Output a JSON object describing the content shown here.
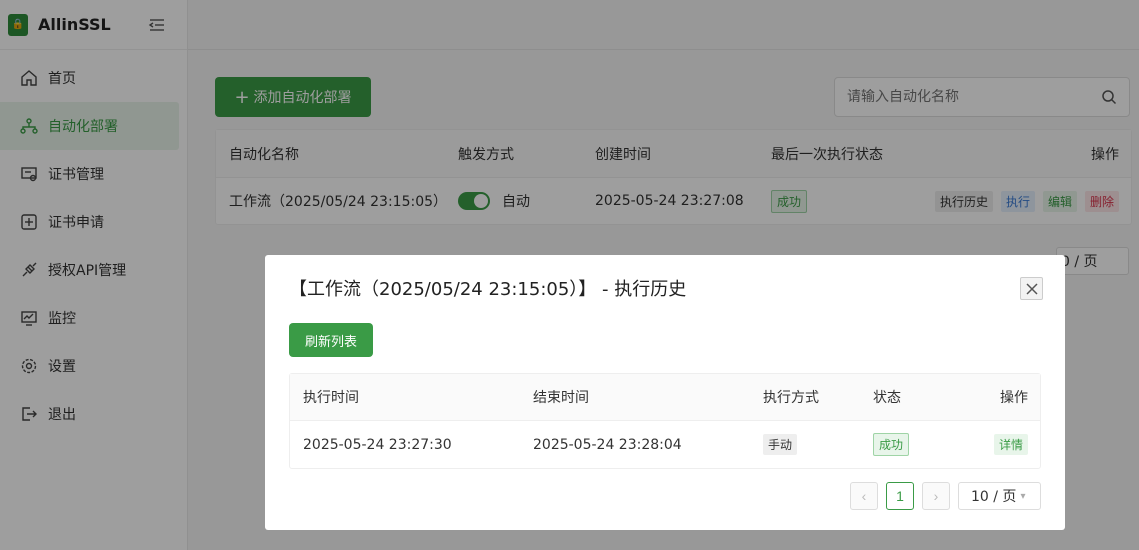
{
  "app": {
    "name": "AllinSSL"
  },
  "sidebar": {
    "items": [
      {
        "label": "首页",
        "icon": "home-icon"
      },
      {
        "label": "自动化部署",
        "icon": "workflow-icon",
        "active": true
      },
      {
        "label": "证书管理",
        "icon": "certificate-icon"
      },
      {
        "label": "证书申请",
        "icon": "plus-square-icon"
      },
      {
        "label": "授权API管理",
        "icon": "api-icon"
      },
      {
        "label": "监控",
        "icon": "monitor-icon"
      },
      {
        "label": "设置",
        "icon": "gear-icon"
      },
      {
        "label": "退出",
        "icon": "logout-icon"
      }
    ]
  },
  "main": {
    "add_button": "添加自动化部署",
    "search_placeholder": "请输入自动化名称",
    "table": {
      "headers": [
        "自动化名称",
        "触发方式",
        "创建时间",
        "最后一次执行状态",
        "操作"
      ],
      "rows": [
        {
          "name": "工作流（2025/05/24 23:15:05）",
          "trigger": "自动",
          "created": "2025-05-24 23:27:08",
          "status": "成功",
          "actions": [
            "执行历史",
            "执行",
            "编辑",
            "删除"
          ]
        }
      ]
    },
    "page_size": "0 / 页"
  },
  "modal": {
    "title": "【工作流（2025/05/24 23:15:05）】 - 执行历史",
    "refresh_button": "刷新列表",
    "table": {
      "headers": [
        "执行时间",
        "结束时间",
        "执行方式",
        "状态",
        "操作"
      ],
      "rows": [
        {
          "start": "2025-05-24 23:27:30",
          "end": "2025-05-24 23:28:04",
          "mode": "手动",
          "status": "成功",
          "action": "详情"
        }
      ]
    },
    "pager": {
      "current": "1",
      "page_size": "10 / 页"
    }
  },
  "colors": {
    "accent": "#3a9b46",
    "danger": "#d9344d",
    "info": "#3a7bd5"
  }
}
